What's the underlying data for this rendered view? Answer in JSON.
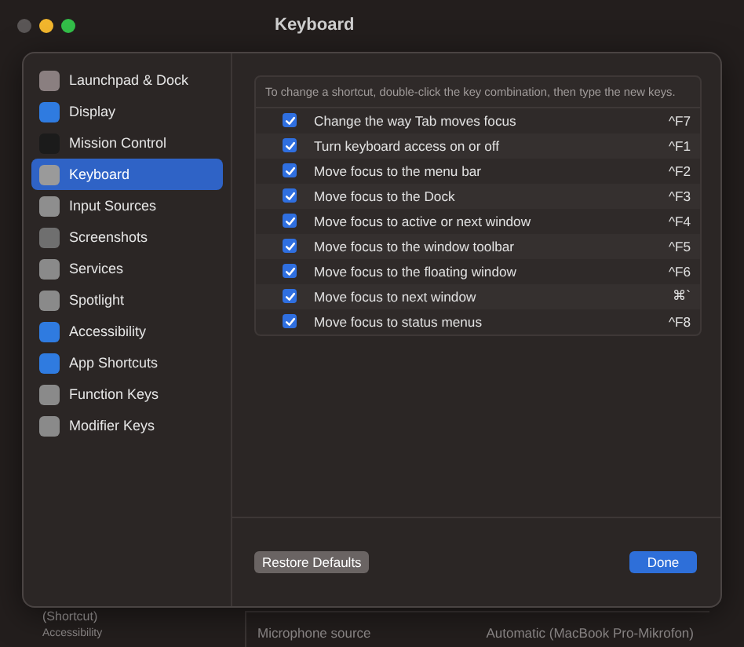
{
  "window": {
    "title": "Keyboard"
  },
  "background": {
    "sidebar_lines": [
      "(Shortcut)",
      "Accessibility"
    ],
    "row_label": "Microphone source",
    "row_value": "Automatic (MacBook Pro-Mikrofon)"
  },
  "sidebar": {
    "items": [
      {
        "label": "Launchpad & Dock",
        "selected": false,
        "color": "#8a7f80"
      },
      {
        "label": "Display",
        "selected": false,
        "color": "#2f7be0"
      },
      {
        "label": "Mission Control",
        "selected": false,
        "color": "#1b1b1b"
      },
      {
        "label": "Keyboard",
        "selected": true,
        "color": "#9a9a9a"
      },
      {
        "label": "Input Sources",
        "selected": false,
        "color": "#8e8e8e"
      },
      {
        "label": "Screenshots",
        "selected": false,
        "color": "#6f6f6f"
      },
      {
        "label": "Services",
        "selected": false,
        "color": "#8a8a8a"
      },
      {
        "label": "Spotlight",
        "selected": false,
        "color": "#8a8a8a"
      },
      {
        "label": "Accessibility",
        "selected": false,
        "color": "#2f7be0"
      },
      {
        "label": "App Shortcuts",
        "selected": false,
        "color": "#2f7be0"
      },
      {
        "label": "Function Keys",
        "selected": false,
        "color": "#8a8a8a"
      },
      {
        "label": "Modifier Keys",
        "selected": false,
        "color": "#8a8a8a"
      }
    ]
  },
  "hint": "To change a shortcut, double-click the key combination, then type the new keys.",
  "shortcuts": [
    {
      "label": "Change the way Tab moves focus",
      "keys": "^F7",
      "checked": true
    },
    {
      "label": "Turn keyboard access on or off",
      "keys": "^F1",
      "checked": true
    },
    {
      "label": "Move focus to the menu bar",
      "keys": "^F2",
      "checked": true
    },
    {
      "label": "Move focus to the Dock",
      "keys": "^F3",
      "checked": true
    },
    {
      "label": "Move focus to active or next window",
      "keys": "^F4",
      "checked": true
    },
    {
      "label": "Move focus to the window toolbar",
      "keys": "^F5",
      "checked": true
    },
    {
      "label": "Move focus to the floating window",
      "keys": "^F6",
      "checked": true
    },
    {
      "label": "Move focus to next window",
      "keys": "⌘`",
      "checked": true
    },
    {
      "label": "Move focus to status menus",
      "keys": "^F8",
      "checked": true
    }
  ],
  "buttons": {
    "secondary": "Restore Defaults",
    "primary": "Done"
  }
}
